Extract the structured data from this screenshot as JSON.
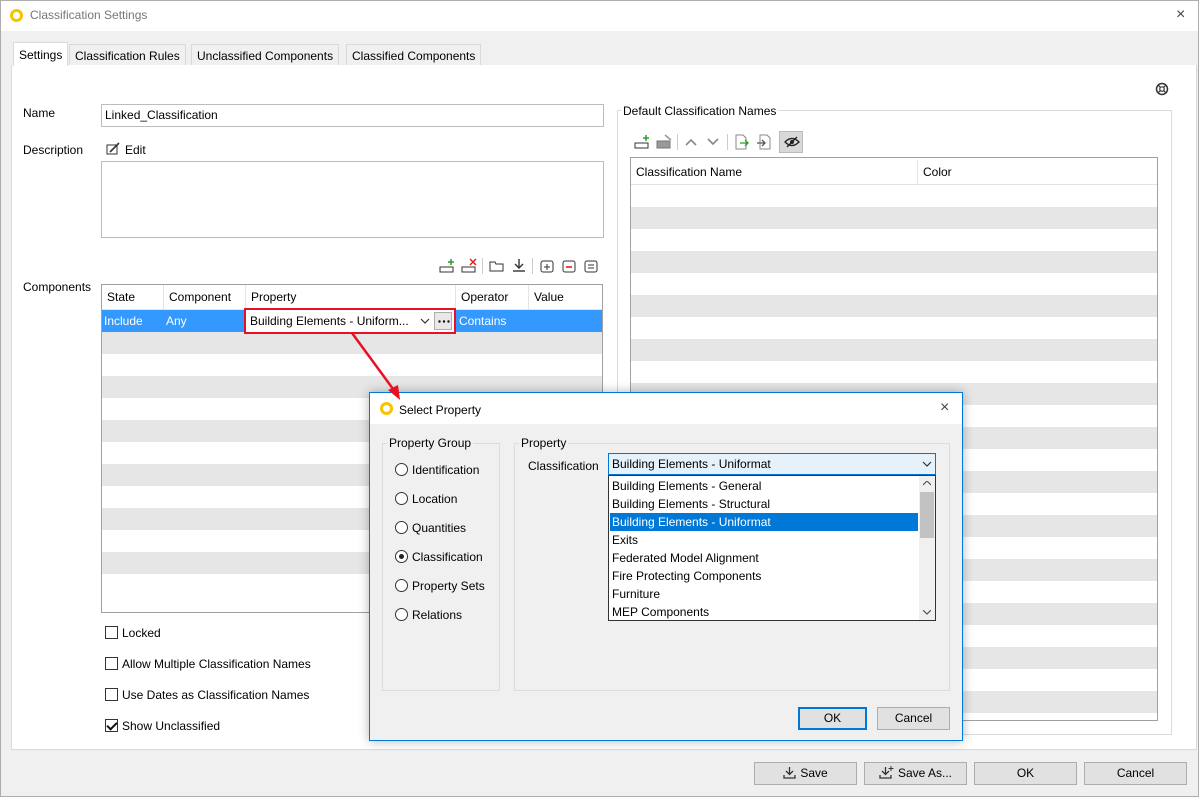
{
  "window": {
    "title": "Classification Settings",
    "close_icon": "×"
  },
  "tabs": [
    {
      "label": "Settings",
      "active": true
    },
    {
      "label": "Classification Rules"
    },
    {
      "label": "Unclassified Components"
    },
    {
      "label": "Classified Components"
    }
  ],
  "settings": {
    "name_label": "Name",
    "name_value": "Linked_Classification",
    "description_label": "Description",
    "edit_label": "Edit",
    "components_label": "Components",
    "components_grid": {
      "columns": [
        "State",
        "Component",
        "Property",
        "Operator",
        "Value"
      ],
      "rows": [
        {
          "state": "Include",
          "component": "Any",
          "property": "Building Elements - Uniform...",
          "operator": "Contains",
          "value": ""
        }
      ]
    },
    "checkboxes": {
      "locked": {
        "label": "Locked",
        "checked": false
      },
      "allow_multiple": {
        "label": "Allow Multiple Classification Names",
        "checked": false
      },
      "use_dates": {
        "label": "Use Dates as Classification Names",
        "checked": false
      },
      "show_unclassified": {
        "label": "Show Unclassified",
        "checked": true
      }
    }
  },
  "default_names": {
    "title": "Default Classification Names",
    "columns": [
      "Classification Name",
      "Color"
    ]
  },
  "footer": {
    "save": "Save",
    "save_as": "Save As...",
    "ok": "OK",
    "cancel": "Cancel"
  },
  "select_property_dialog": {
    "title": "Select Property",
    "property_group_label": "Property Group",
    "groups": [
      {
        "label": "Identification",
        "selected": false
      },
      {
        "label": "Location",
        "selected": false
      },
      {
        "label": "Quantities",
        "selected": false
      },
      {
        "label": "Classification",
        "selected": true
      },
      {
        "label": "Property Sets",
        "selected": false
      },
      {
        "label": "Relations",
        "selected": false
      }
    ],
    "property_label": "Property",
    "classification_label": "Classification",
    "classification_value": "Building Elements - Uniformat",
    "options": [
      "Building Elements - General",
      "Building Elements - Structural",
      "Building Elements - Uniformat",
      "Exits",
      "Federated Model Alignment",
      "Fire Protecting Components",
      "Furniture",
      "MEP Components"
    ],
    "selected_option_index": 2,
    "ok": "OK",
    "cancel": "Cancel"
  },
  "colors": {
    "accent": "#0078d7",
    "selection_row": "#3399ff",
    "highlight_box": "#e81123",
    "logo": "#f5c400"
  }
}
